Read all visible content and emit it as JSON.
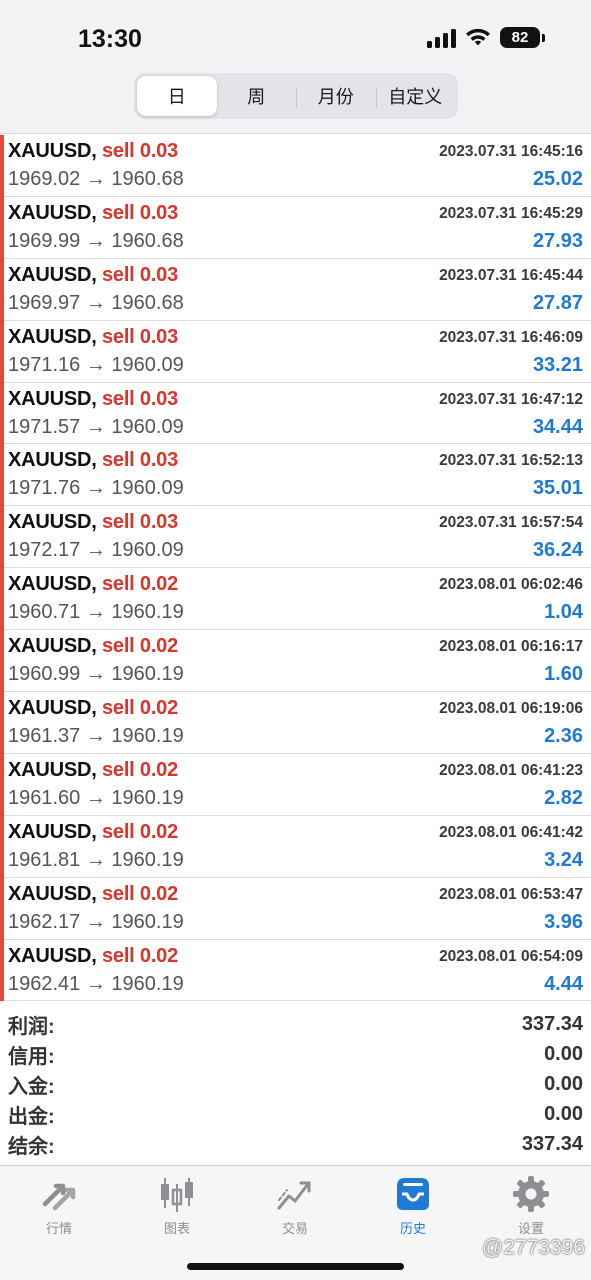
{
  "status_bar": {
    "time": "13:30",
    "battery": "82"
  },
  "segments": [
    {
      "label": "日",
      "active": true
    },
    {
      "label": "周",
      "active": false
    },
    {
      "label": "月份",
      "active": false
    },
    {
      "label": "自定义",
      "active": false
    }
  ],
  "trades": [
    {
      "symbol": "XAUUSD,",
      "side": "sell 0.03",
      "datetime": "2023.07.31 16:45:16",
      "prices": "1969.02 → 1960.68",
      "profit": "25.02"
    },
    {
      "symbol": "XAUUSD,",
      "side": "sell 0.03",
      "datetime": "2023.07.31 16:45:29",
      "prices": "1969.99 → 1960.68",
      "profit": "27.93"
    },
    {
      "symbol": "XAUUSD,",
      "side": "sell 0.03",
      "datetime": "2023.07.31 16:45:44",
      "prices": "1969.97 → 1960.68",
      "profit": "27.87"
    },
    {
      "symbol": "XAUUSD,",
      "side": "sell 0.03",
      "datetime": "2023.07.31 16:46:09",
      "prices": "1971.16 → 1960.09",
      "profit": "33.21"
    },
    {
      "symbol": "XAUUSD,",
      "side": "sell 0.03",
      "datetime": "2023.07.31 16:47:12",
      "prices": "1971.57 → 1960.09",
      "profit": "34.44"
    },
    {
      "symbol": "XAUUSD,",
      "side": "sell 0.03",
      "datetime": "2023.07.31 16:52:13",
      "prices": "1971.76 → 1960.09",
      "profit": "35.01"
    },
    {
      "symbol": "XAUUSD,",
      "side": "sell 0.03",
      "datetime": "2023.07.31 16:57:54",
      "prices": "1972.17 → 1960.09",
      "profit": "36.24"
    },
    {
      "symbol": "XAUUSD,",
      "side": "sell 0.02",
      "datetime": "2023.08.01 06:02:46",
      "prices": "1960.71 → 1960.19",
      "profit": "1.04"
    },
    {
      "symbol": "XAUUSD,",
      "side": "sell 0.02",
      "datetime": "2023.08.01 06:16:17",
      "prices": "1960.99 → 1960.19",
      "profit": "1.60"
    },
    {
      "symbol": "XAUUSD,",
      "side": "sell 0.02",
      "datetime": "2023.08.01 06:19:06",
      "prices": "1961.37 → 1960.19",
      "profit": "2.36"
    },
    {
      "symbol": "XAUUSD,",
      "side": "sell 0.02",
      "datetime": "2023.08.01 06:41:23",
      "prices": "1961.60 → 1960.19",
      "profit": "2.82"
    },
    {
      "symbol": "XAUUSD,",
      "side": "sell 0.02",
      "datetime": "2023.08.01 06:41:42",
      "prices": "1961.81 → 1960.19",
      "profit": "3.24"
    },
    {
      "symbol": "XAUUSD,",
      "side": "sell 0.02",
      "datetime": "2023.08.01 06:53:47",
      "prices": "1962.17 → 1960.19",
      "profit": "3.96"
    },
    {
      "symbol": "XAUUSD,",
      "side": "sell 0.02",
      "datetime": "2023.08.01 06:54:09",
      "prices": "1962.41 → 1960.19",
      "profit": "4.44"
    }
  ],
  "summary": [
    {
      "label": "利润:",
      "value": "337.34"
    },
    {
      "label": "信用:",
      "value": "0.00"
    },
    {
      "label": "入金:",
      "value": "0.00"
    },
    {
      "label": "出金:",
      "value": "0.00"
    },
    {
      "label": "结余:",
      "value": "337.34"
    }
  ],
  "tabs": [
    {
      "label": "行情",
      "icon": "quotes-arrows-icon",
      "active": false
    },
    {
      "label": "图表",
      "icon": "candlestick-chart-icon",
      "active": false
    },
    {
      "label": "交易",
      "icon": "trade-trend-icon",
      "active": false
    },
    {
      "label": "历史",
      "icon": "history-inbox-icon",
      "active": true
    },
    {
      "label": "设置",
      "icon": "gear-icon",
      "active": false
    }
  ],
  "watermark": "@2773396",
  "colors": {
    "sell": "#d9362b",
    "profit": "#1f7ad6",
    "accent_bar": "#e14b3b",
    "tab_active": "#1f7ad6",
    "tab_inactive": "#8e8e93"
  }
}
